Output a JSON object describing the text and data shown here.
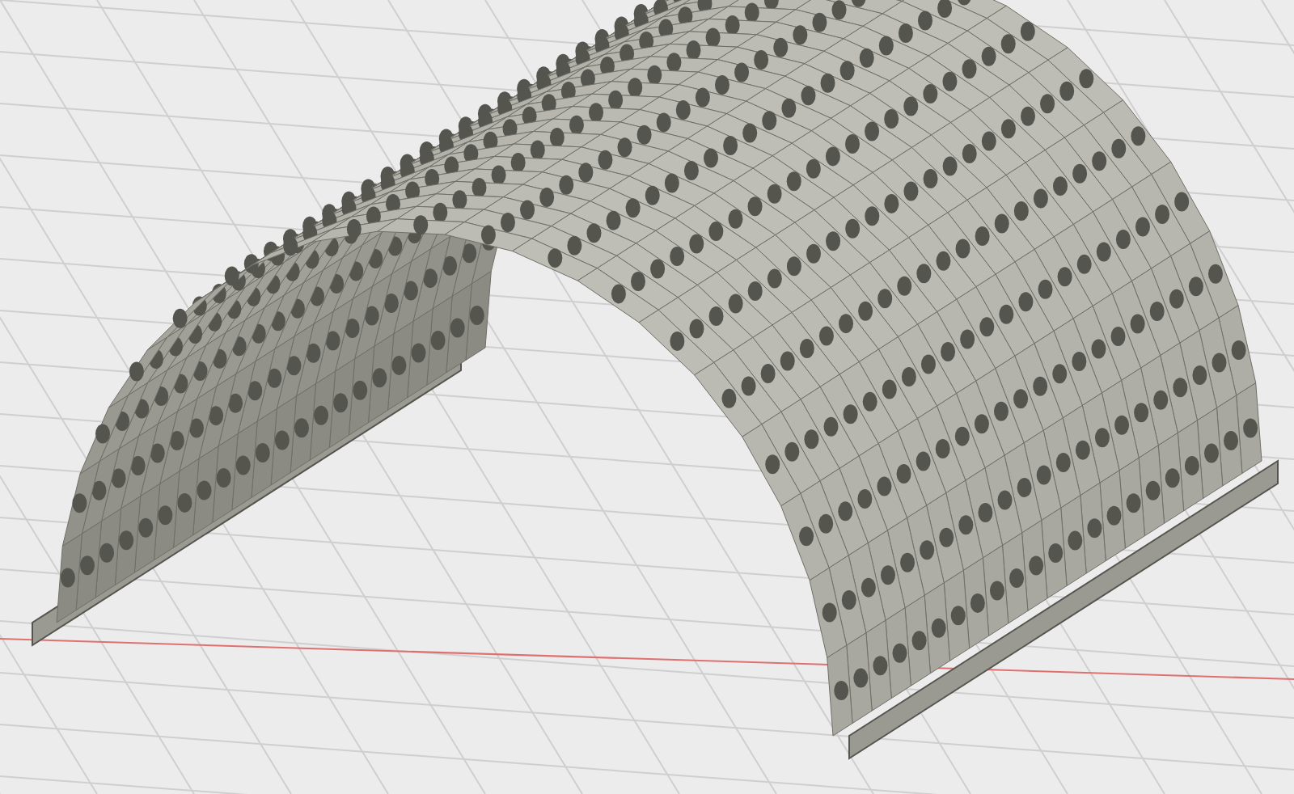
{
  "viewport": {
    "grid": true,
    "model": {
      "kind": "perforated-arch"
    }
  }
}
